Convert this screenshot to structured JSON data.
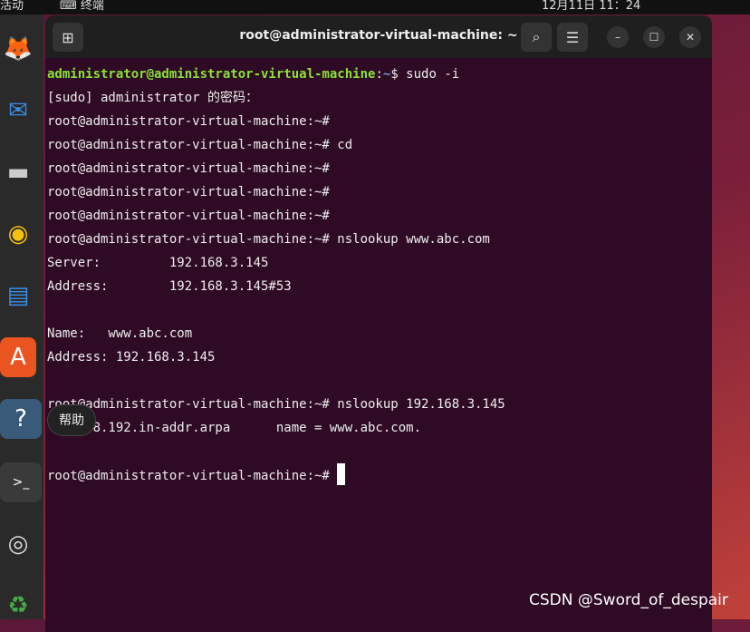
{
  "topbar": {
    "activities": "活动",
    "app": "终端",
    "clock": "12月11日  11：24"
  },
  "window": {
    "title": "root@administrator-virtual-machine: ~"
  },
  "terminal": {
    "user": "administrator@administrator-virtual-machine",
    "path": "~",
    "cmd0": "$ sudo -i",
    "lines": [
      "[sudo] administrator 的密码：",
      "root@administrator-virtual-machine:~# ",
      "root@administrator-virtual-machine:~# cd",
      "root@administrator-virtual-machine:~# ",
      "root@administrator-virtual-machine:~# ",
      "root@administrator-virtual-machine:~# ",
      "root@administrator-virtual-machine:~# nslookup www.abc.com",
      "Server:         192.168.3.145",
      "Address:        192.168.3.145#53",
      "",
      "Name:   www.abc.com",
      "Address: 192.168.3.145",
      "",
      "root@administrator-virtual-machine:~# nslookup 192.168.3.145",
      "    168.192.in-addr.arpa      name = www.abc.com.",
      "",
      "root@administrator-virtual-machine:~# "
    ]
  },
  "tooltip": "帮助",
  "watermark": "CSDN @Sword_of_despair"
}
